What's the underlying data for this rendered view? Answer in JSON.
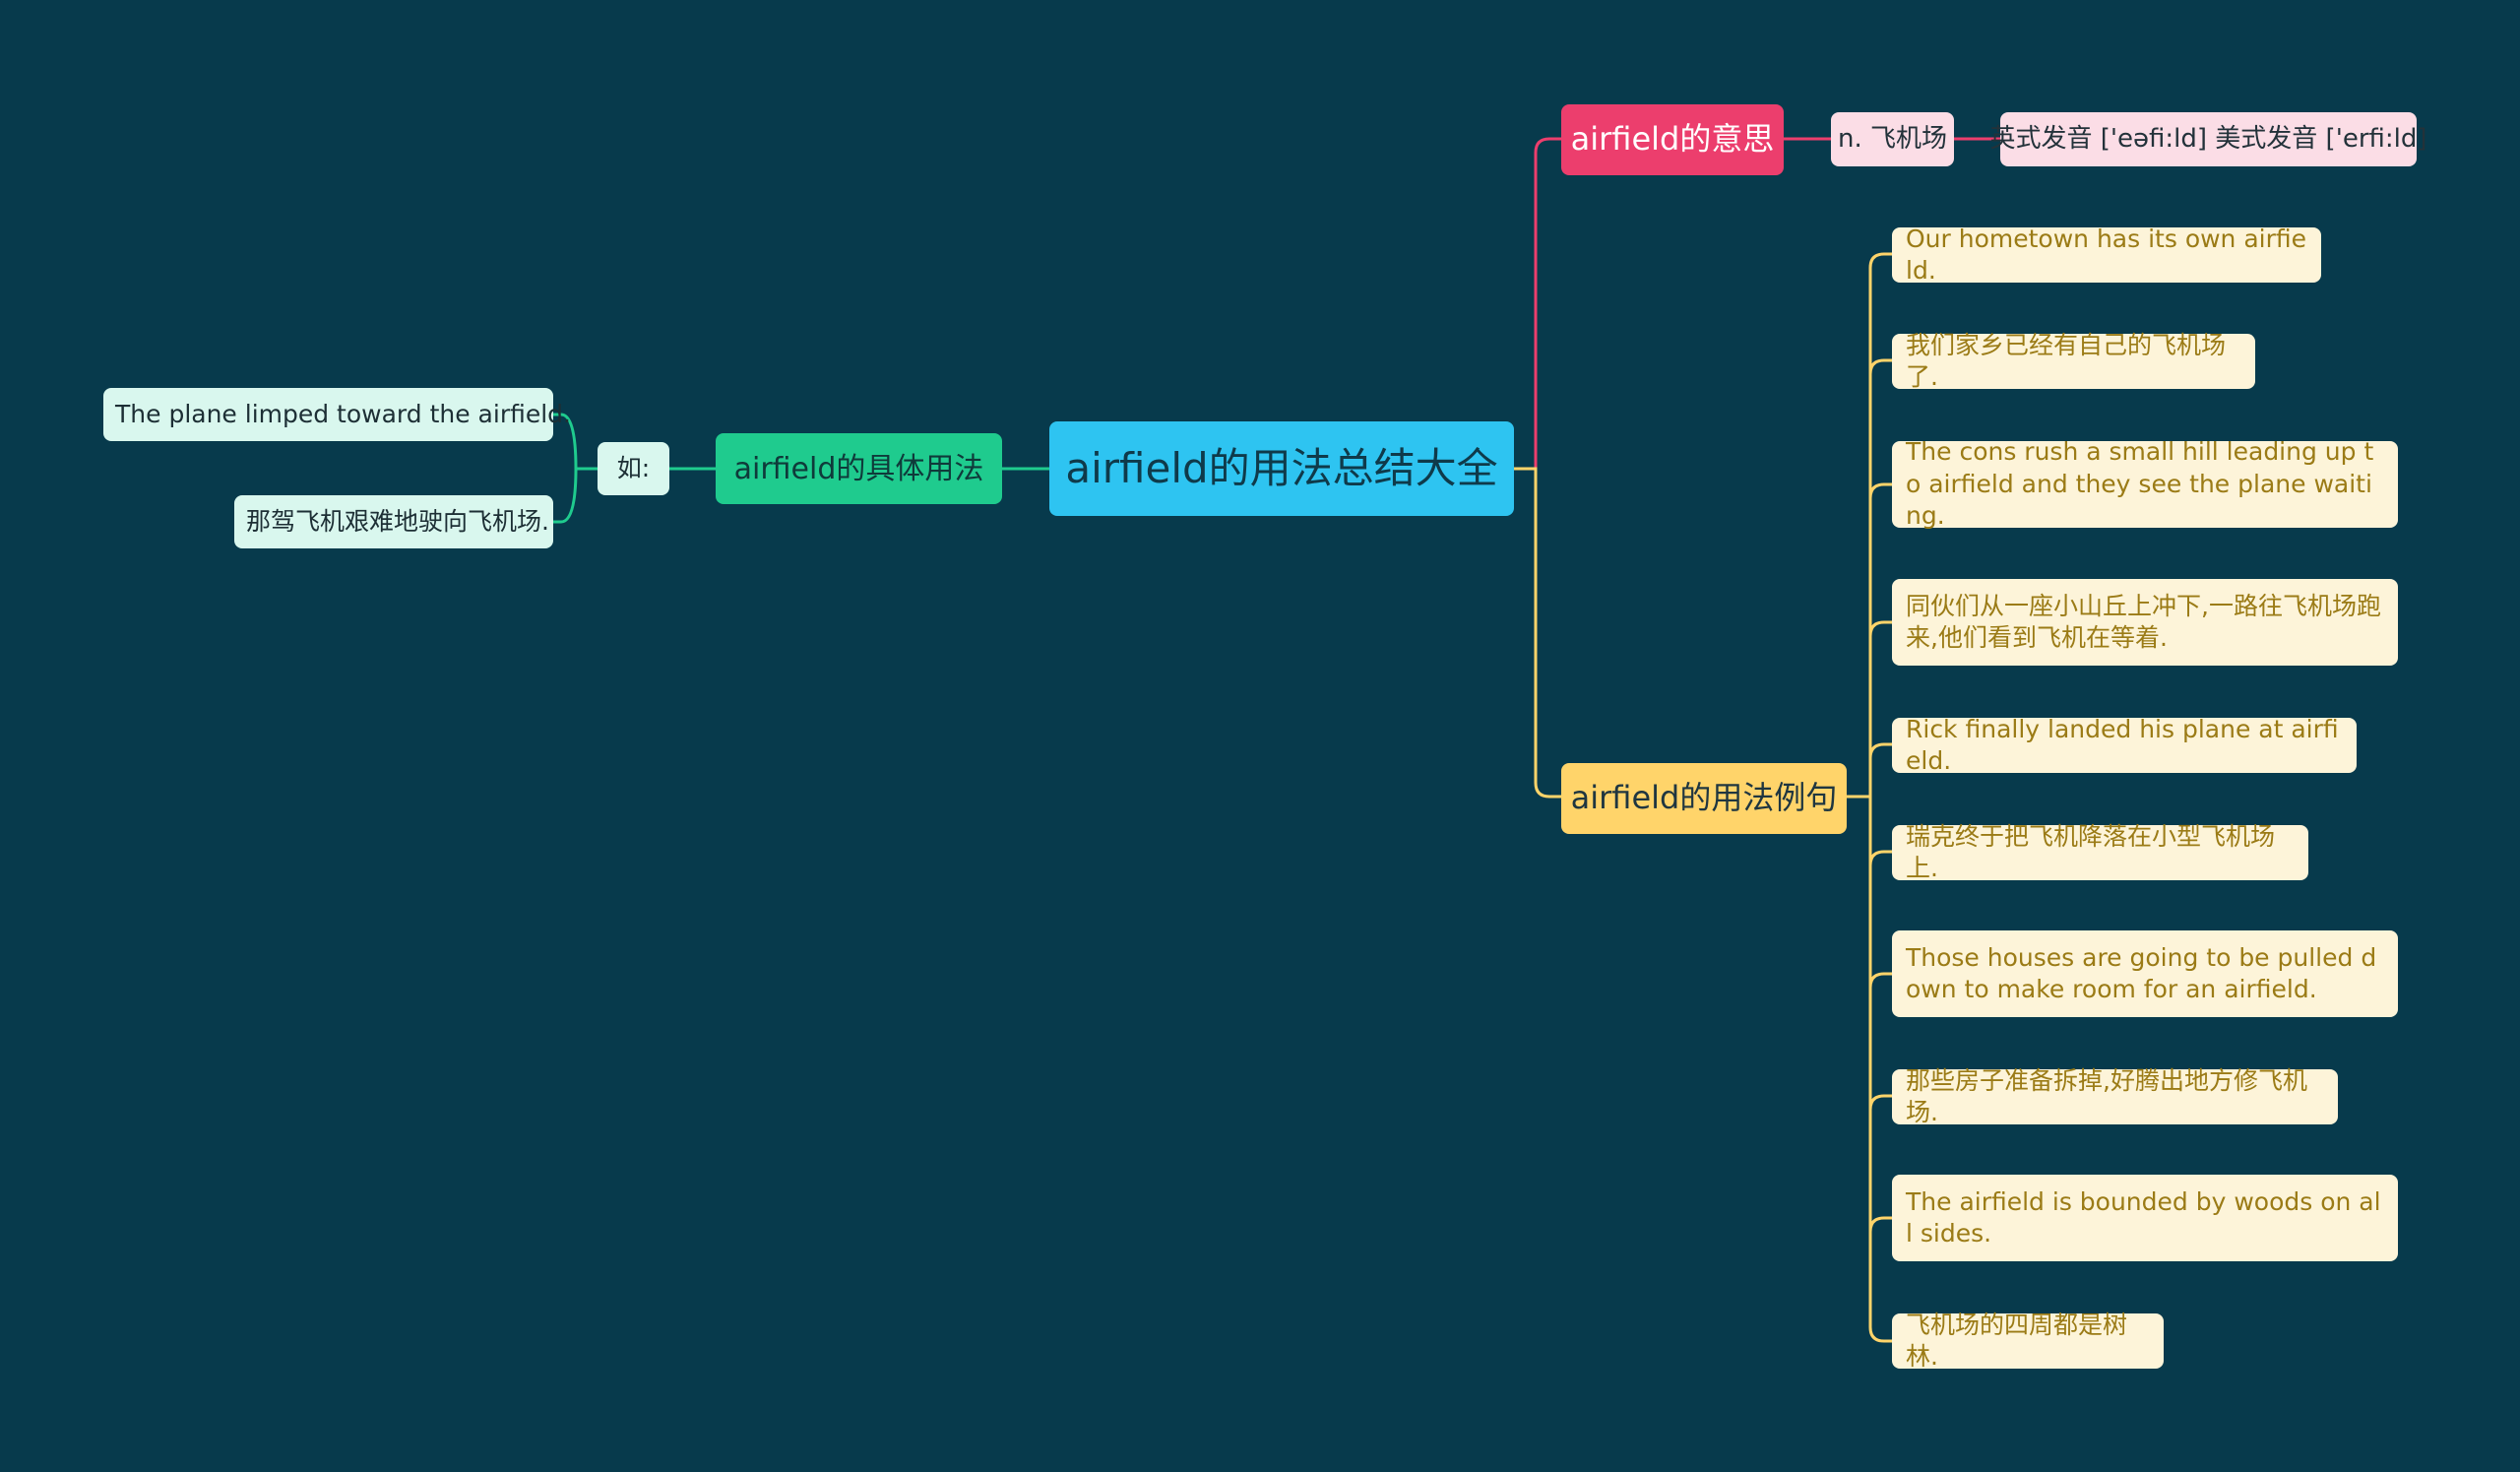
{
  "root": {
    "label": "airfield的用法总结大全"
  },
  "usage_branch": {
    "label": "airfield的具体用法",
    "example_label": "如:",
    "examples": [
      {
        "text": "The plane limped toward the airfield."
      },
      {
        "text": "那驾飞机艰难地驶向飞机场."
      }
    ]
  },
  "meaning_branch": {
    "label": "airfield的意思",
    "definition": "n. 飞机场",
    "pronunciation": "英式发音 ['eəfi:ld] 美式发音 ['erfi:ld]"
  },
  "sentences_branch": {
    "label": "airfield的用法例句",
    "sentences": [
      {
        "text": "Our hometown has its own airfield."
      },
      {
        "text": "我们家乡已经有自己的飞机场了."
      },
      {
        "text": "The cons rush a small hill leading up to airfield and they see the plane waiting."
      },
      {
        "text": "同伙们从一座小山丘上冲下,一路往飞机场跑来,他们看到飞机在等着."
      },
      {
        "text": "Rick finally landed his plane at airfield."
      },
      {
        "text": "瑞克终于把飞机降落在小型飞机场上."
      },
      {
        "text": "Those houses are going to be pulled down to make room for an airfield."
      },
      {
        "text": "那些房子准备拆掉,好腾出地方修飞机场."
      },
      {
        "text": "The airfield is bounded by woods on all sides."
      },
      {
        "text": "飞机场的四周都是树林."
      }
    ]
  },
  "colors": {
    "background": "#073a4c",
    "root": "#2ec4f1",
    "usage_branch": "#1fcb8e",
    "meaning_branch": "#ec3e6d",
    "sentences_branch": "#ffd46a",
    "cream_leaf": "#fdf4d9",
    "pink_leaf": "#fbdde6",
    "mint_leaf": "#d9f7ee"
  }
}
